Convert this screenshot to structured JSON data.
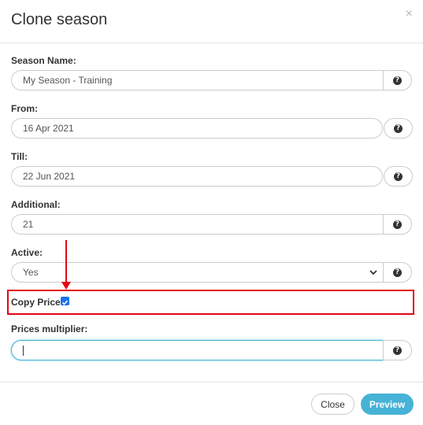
{
  "dialog": {
    "title": "Clone season",
    "close_symbol": "×"
  },
  "fields": {
    "season_name": {
      "label": "Season Name:",
      "value": "My Season - Training"
    },
    "from": {
      "label": "From:",
      "value": "16 Apr 2021"
    },
    "till": {
      "label": "Till:",
      "value": "22 Jun 2021"
    },
    "additional": {
      "label": "Additional:",
      "value": "21"
    },
    "active": {
      "label": "Active:",
      "value": "Yes"
    },
    "copy_prices": {
      "label": "Copy Prices:",
      "checked": true
    },
    "prices_multiplier": {
      "label": "Prices multiplier:",
      "value": ""
    }
  },
  "help_symbol": "?",
  "footer": {
    "close_label": "Close",
    "preview_label": "Preview"
  },
  "colors": {
    "accent": "#46b2d6",
    "highlight": "#e30613",
    "checkbox": "#1a73e8"
  }
}
